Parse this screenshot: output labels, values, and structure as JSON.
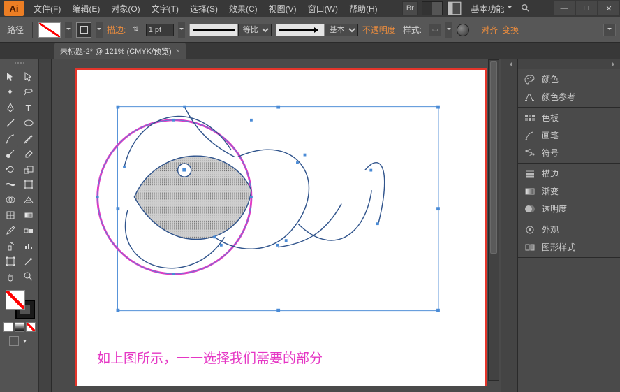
{
  "titlebar": {
    "logo": "Ai",
    "menus": [
      "文件(F)",
      "编辑(E)",
      "对象(O)",
      "文字(T)",
      "选择(S)",
      "效果(C)",
      "视图(V)",
      "窗口(W)",
      "帮助(H)"
    ],
    "bridge": "Br",
    "preset": "基本功能",
    "win": {
      "min": "—",
      "max": "□",
      "close": "✕"
    }
  },
  "controlbar": {
    "mode": "路径",
    "stroke_label": "描边:",
    "stroke_w_icon": "⇅",
    "stroke_value": "1 pt",
    "profile1": "等比",
    "profile2": "基本",
    "opacity": "不透明度",
    "style": "样式:",
    "align": "对齐",
    "transform": "变换"
  },
  "tab": {
    "title": "未标题-2* @ 121% (CMYK/预览)",
    "close": "×"
  },
  "canvas": {
    "caption": "如上图所示，一一选择我们需要的部分"
  },
  "panels": {
    "g1": [
      "颜色",
      "颜色参考"
    ],
    "g2": [
      "色板",
      "画笔",
      "符号"
    ],
    "g3": [
      "描边",
      "渐变",
      "透明度"
    ],
    "g4": [
      "外观",
      "图形样式"
    ]
  }
}
